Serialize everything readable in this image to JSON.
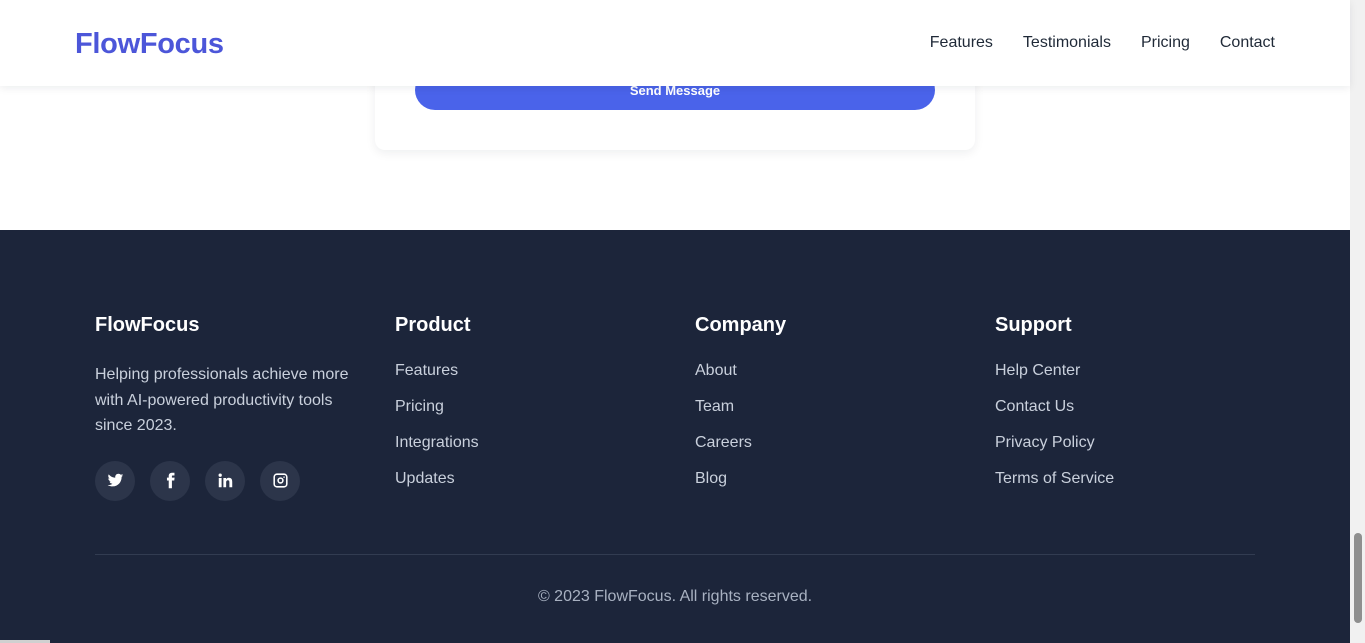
{
  "header": {
    "logo": "FlowFocus",
    "nav": [
      "Features",
      "Testimonials",
      "Pricing",
      "Contact"
    ]
  },
  "contact_form": {
    "submit_label": "Send Message"
  },
  "footer": {
    "brand": {
      "title": "FlowFocus",
      "description": "Helping professionals achieve more with AI-powered productivity tools since 2023.",
      "socials": [
        "twitter-icon",
        "facebook-icon",
        "linkedin-icon",
        "instagram-icon"
      ]
    },
    "columns": [
      {
        "title": "Product",
        "links": [
          "Features",
          "Pricing",
          "Integrations",
          "Updates"
        ]
      },
      {
        "title": "Company",
        "links": [
          "About",
          "Team",
          "Careers",
          "Blog"
        ]
      },
      {
        "title": "Support",
        "links": [
          "Help Center",
          "Contact Us",
          "Privacy Policy",
          "Terms of Service"
        ]
      }
    ],
    "copyright": "© 2023 FlowFocus. All rights reserved."
  },
  "colors": {
    "accent": "#4a63ea",
    "logo": "#4c56d9",
    "footer_bg": "#1c253a"
  }
}
